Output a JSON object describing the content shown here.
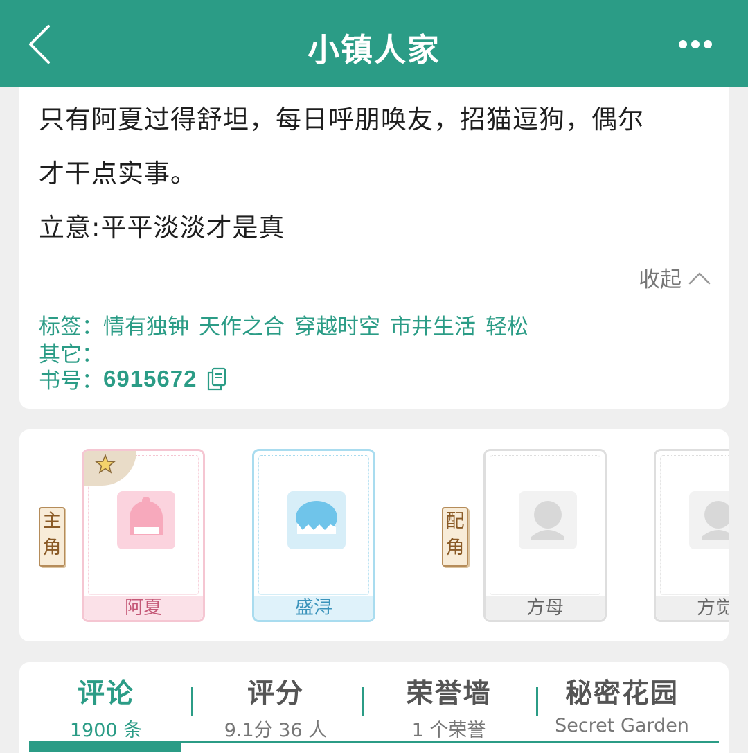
{
  "header": {
    "title": "小镇人家",
    "back_icon": "chevron-left-icon",
    "more_icon": "more-horizontal-icon"
  },
  "intro": {
    "line1": "只有阿夏过得舒坦，每日呼朋唤友，招猫逗狗，偶尔",
    "line2": "才干点实事。",
    "line3": "立意:平平淡淡才是真",
    "collapse_label": "收起"
  },
  "meta": {
    "tags_label": "标签：",
    "tags": [
      "情有独钟",
      "天作之合",
      "穿越时空",
      "市井生活",
      "轻松"
    ],
    "other_label": "其它：",
    "book_no_label": "书号：",
    "book_no": "6915672"
  },
  "characters": {
    "lead_badge": "主角",
    "support_badge": "配角",
    "items": [
      {
        "name": "阿夏",
        "theme": "pink",
        "starred": true
      },
      {
        "name": "盛浔",
        "theme": "blue",
        "starred": false
      },
      {
        "name": "方母",
        "theme": "grey",
        "starred": false
      },
      {
        "name": "方觉",
        "theme": "grey",
        "starred": false
      }
    ]
  },
  "tabs": [
    {
      "title": "评论",
      "subtitle": "1900 条",
      "active": true
    },
    {
      "title": "评分",
      "subtitle": "9.1分 36 人",
      "active": false
    },
    {
      "title": "荣誉墙",
      "subtitle": "1 个荣誉",
      "active": false
    },
    {
      "title": "秘密花园",
      "subtitle": "Secret Garden",
      "active": false
    }
  ],
  "colors": {
    "brand": "#2b9c86",
    "pink": "#f5c6d2",
    "blue": "#a9dcef",
    "grey": "#dedede"
  }
}
